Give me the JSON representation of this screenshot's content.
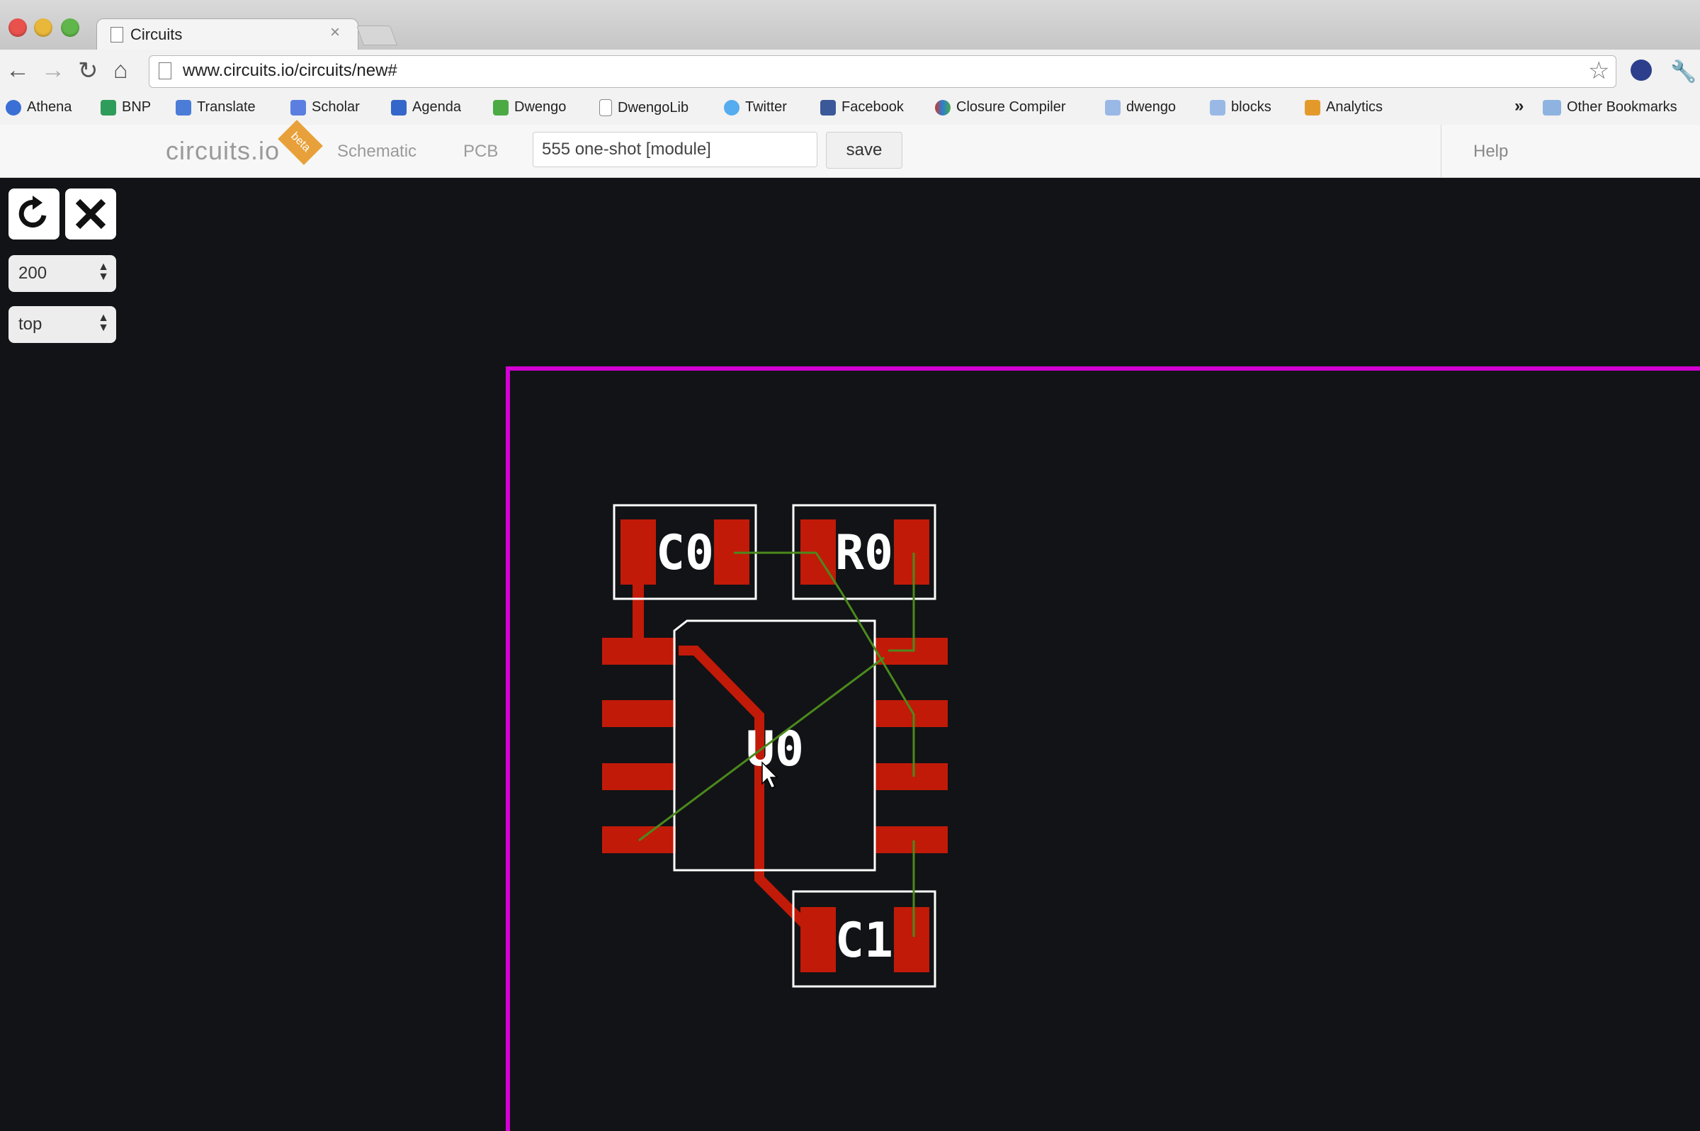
{
  "browser": {
    "tab_title": "Circuits",
    "tab_close": "×",
    "url": "www.circuits.io/circuits/new#",
    "bookmarks": [
      {
        "label": "Athena",
        "color": "#3b6fd6"
      },
      {
        "label": "BNP",
        "color": "#2e9c5a"
      },
      {
        "label": "Translate",
        "color": "#4a7cd8"
      },
      {
        "label": "Scholar",
        "color": "#5b7fe0"
      },
      {
        "label": "Agenda",
        "color": "#3566c9"
      },
      {
        "label": "Dwengo",
        "color": "#4caa45"
      },
      {
        "label": "DwengoLib",
        "color": "#dddddd"
      },
      {
        "label": "Twitter",
        "color": "#55acee"
      },
      {
        "label": "Facebook",
        "color": "#3b5998"
      },
      {
        "label": "Closure Compiler",
        "color": "#c53c30"
      },
      {
        "label": "dwengo",
        "color": "#9ab8e6"
      },
      {
        "label": "blocks",
        "color": "#9ab8e6"
      },
      {
        "label": "Analytics",
        "color": "#e49a2b"
      }
    ],
    "overflow_label": "»",
    "other_bookmarks": "Other Bookmarks"
  },
  "app": {
    "logo": "circuits.io",
    "beta": "beta",
    "nav": [
      "Schematic",
      "PCB"
    ],
    "circuit_name": "555 one-shot [module]",
    "save_label": "save",
    "help_label": "Help"
  },
  "tools": {
    "zoom_value": "200",
    "layer_value": "top"
  },
  "pcb": {
    "board_color": "#d400d4",
    "copper_color": "#c21a08",
    "ratsnest_color": "#4a8a1c",
    "components": [
      {
        "ref": "C0"
      },
      {
        "ref": "R0"
      },
      {
        "ref": "U0"
      },
      {
        "ref": "C1"
      }
    ]
  }
}
